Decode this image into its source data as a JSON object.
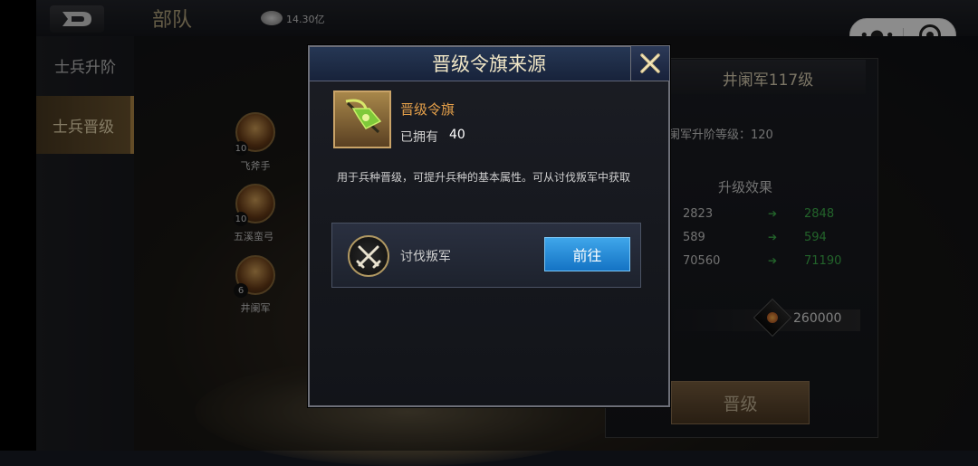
{
  "topbar": {
    "title": "部队",
    "currency_value": "14.30亿"
  },
  "sidebar": {
    "items": [
      {
        "label": "士兵升阶"
      },
      {
        "label": "士兵晋级"
      }
    ]
  },
  "units": [
    {
      "name": "飞斧手",
      "level": "10"
    },
    {
      "name": "五溪蛮弓",
      "level": "10"
    },
    {
      "name": "井阑军",
      "level": "6"
    }
  ],
  "right_panel": {
    "title": "井阑军117级",
    "promote_level_text": "阑军升阶等级：120",
    "effects_title": "升级效果",
    "stats": [
      {
        "old": "2823",
        "new": "2848"
      },
      {
        "old": "589",
        "new": "594"
      },
      {
        "old": "70560",
        "new": "71190"
      }
    ],
    "cost": "260000",
    "promote_button": "晋级"
  },
  "modal": {
    "title": "晋级令旗来源",
    "item_name": "晋级令旗",
    "owned_label": "已拥有",
    "owned_value": "40",
    "description": "用于兵种晋级，可提升兵种的基本属性。可从讨伐叛军中获取",
    "source_name": "讨伐叛军",
    "goto_button": "前往"
  },
  "colors": {
    "accent_gold": "#e5a04a",
    "goto_blue": "#1f87d6",
    "stat_green": "#3fb54e"
  },
  "icons": {
    "close": "close-x-icon",
    "item": "flag-icon",
    "source": "crossed-swords-icon",
    "back": "back-d-icon",
    "currency": "silver-ingot-icon",
    "cost": "copper-coin-icon"
  }
}
